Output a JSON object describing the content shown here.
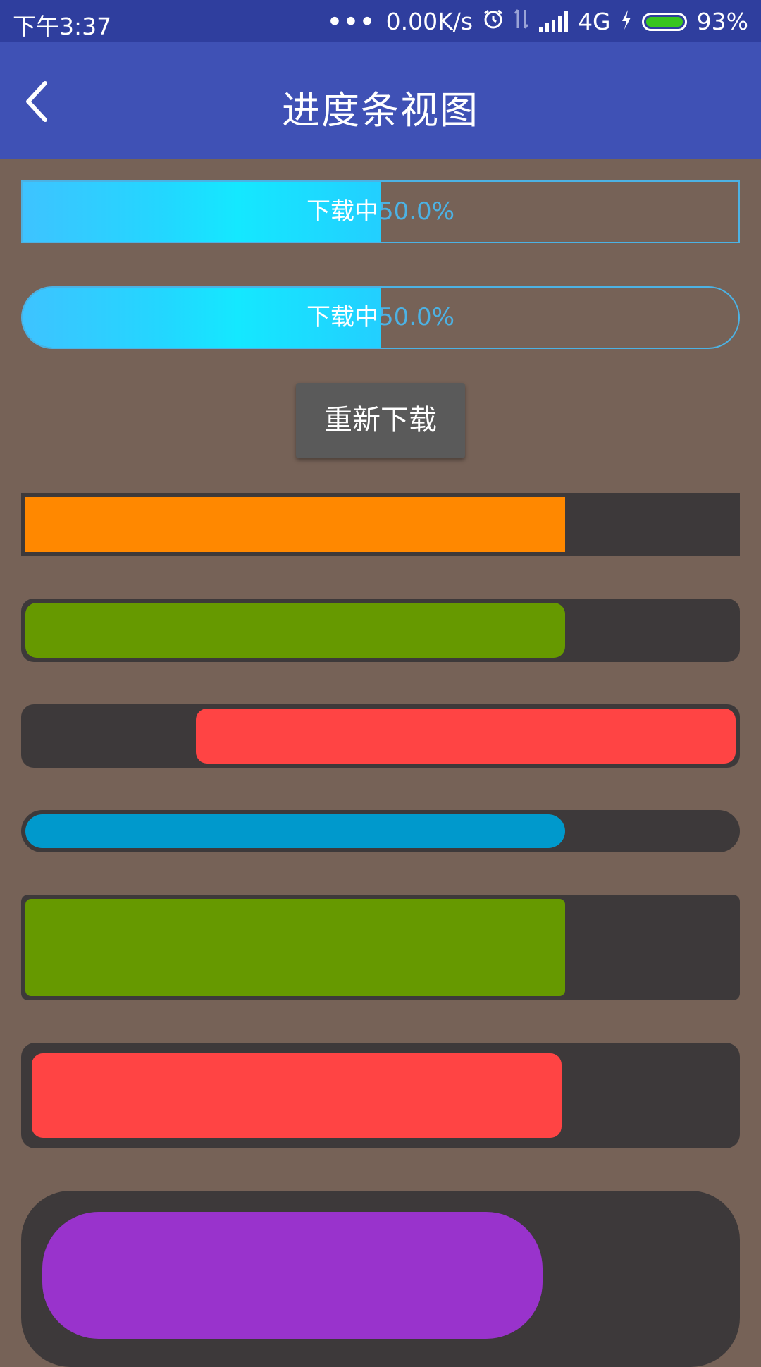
{
  "status_bar": {
    "time": "下午3:37",
    "network_speed": "0.00K/s",
    "network_type": "4G",
    "battery": "93%",
    "icons": [
      "more-dots-icon",
      "alarm-icon",
      "data-transfer-icon",
      "signal-icon",
      "charging-icon",
      "battery-icon"
    ]
  },
  "app_bar": {
    "title": "进度条视图",
    "back_icon": "chevron-left-icon"
  },
  "text_progress_bars": [
    {
      "prefix": "下载中",
      "percent": "50.0%",
      "progress": 0.5,
      "shape": "rect"
    },
    {
      "prefix": "下载中",
      "percent": "50.0%",
      "progress": 0.5,
      "shape": "rounded"
    }
  ],
  "redownload_button": {
    "label": "重新下载"
  },
  "progress_bars": [
    {
      "fill_color": "#ff8800",
      "track_color": "#3d393a",
      "progress": 0.76
    },
    {
      "fill_color": "#669900",
      "track_color": "#3d393a",
      "progress": 0.76
    },
    {
      "fill_color": "#ff4444",
      "track_color": "#3d393a",
      "progress": 0.76,
      "direction": "right-to-left"
    },
    {
      "fill_color": "#0099cc",
      "track_color": "#3d393a",
      "progress": 0.76
    },
    {
      "fill_color": "#669900",
      "track_color": "#3d393a",
      "progress": 0.76
    },
    {
      "fill_color": "#ff4444",
      "track_color": "#3d393a",
      "progress": 0.76
    },
    {
      "fill_color": "#9933cc",
      "track_color": "#3d393a",
      "progress": 0.74
    }
  ],
  "colors": {
    "background": "#766257",
    "status_bar": "#2f3e9e",
    "app_bar": "#3f51b5",
    "text_bar_accent": "#4cb2e4"
  }
}
